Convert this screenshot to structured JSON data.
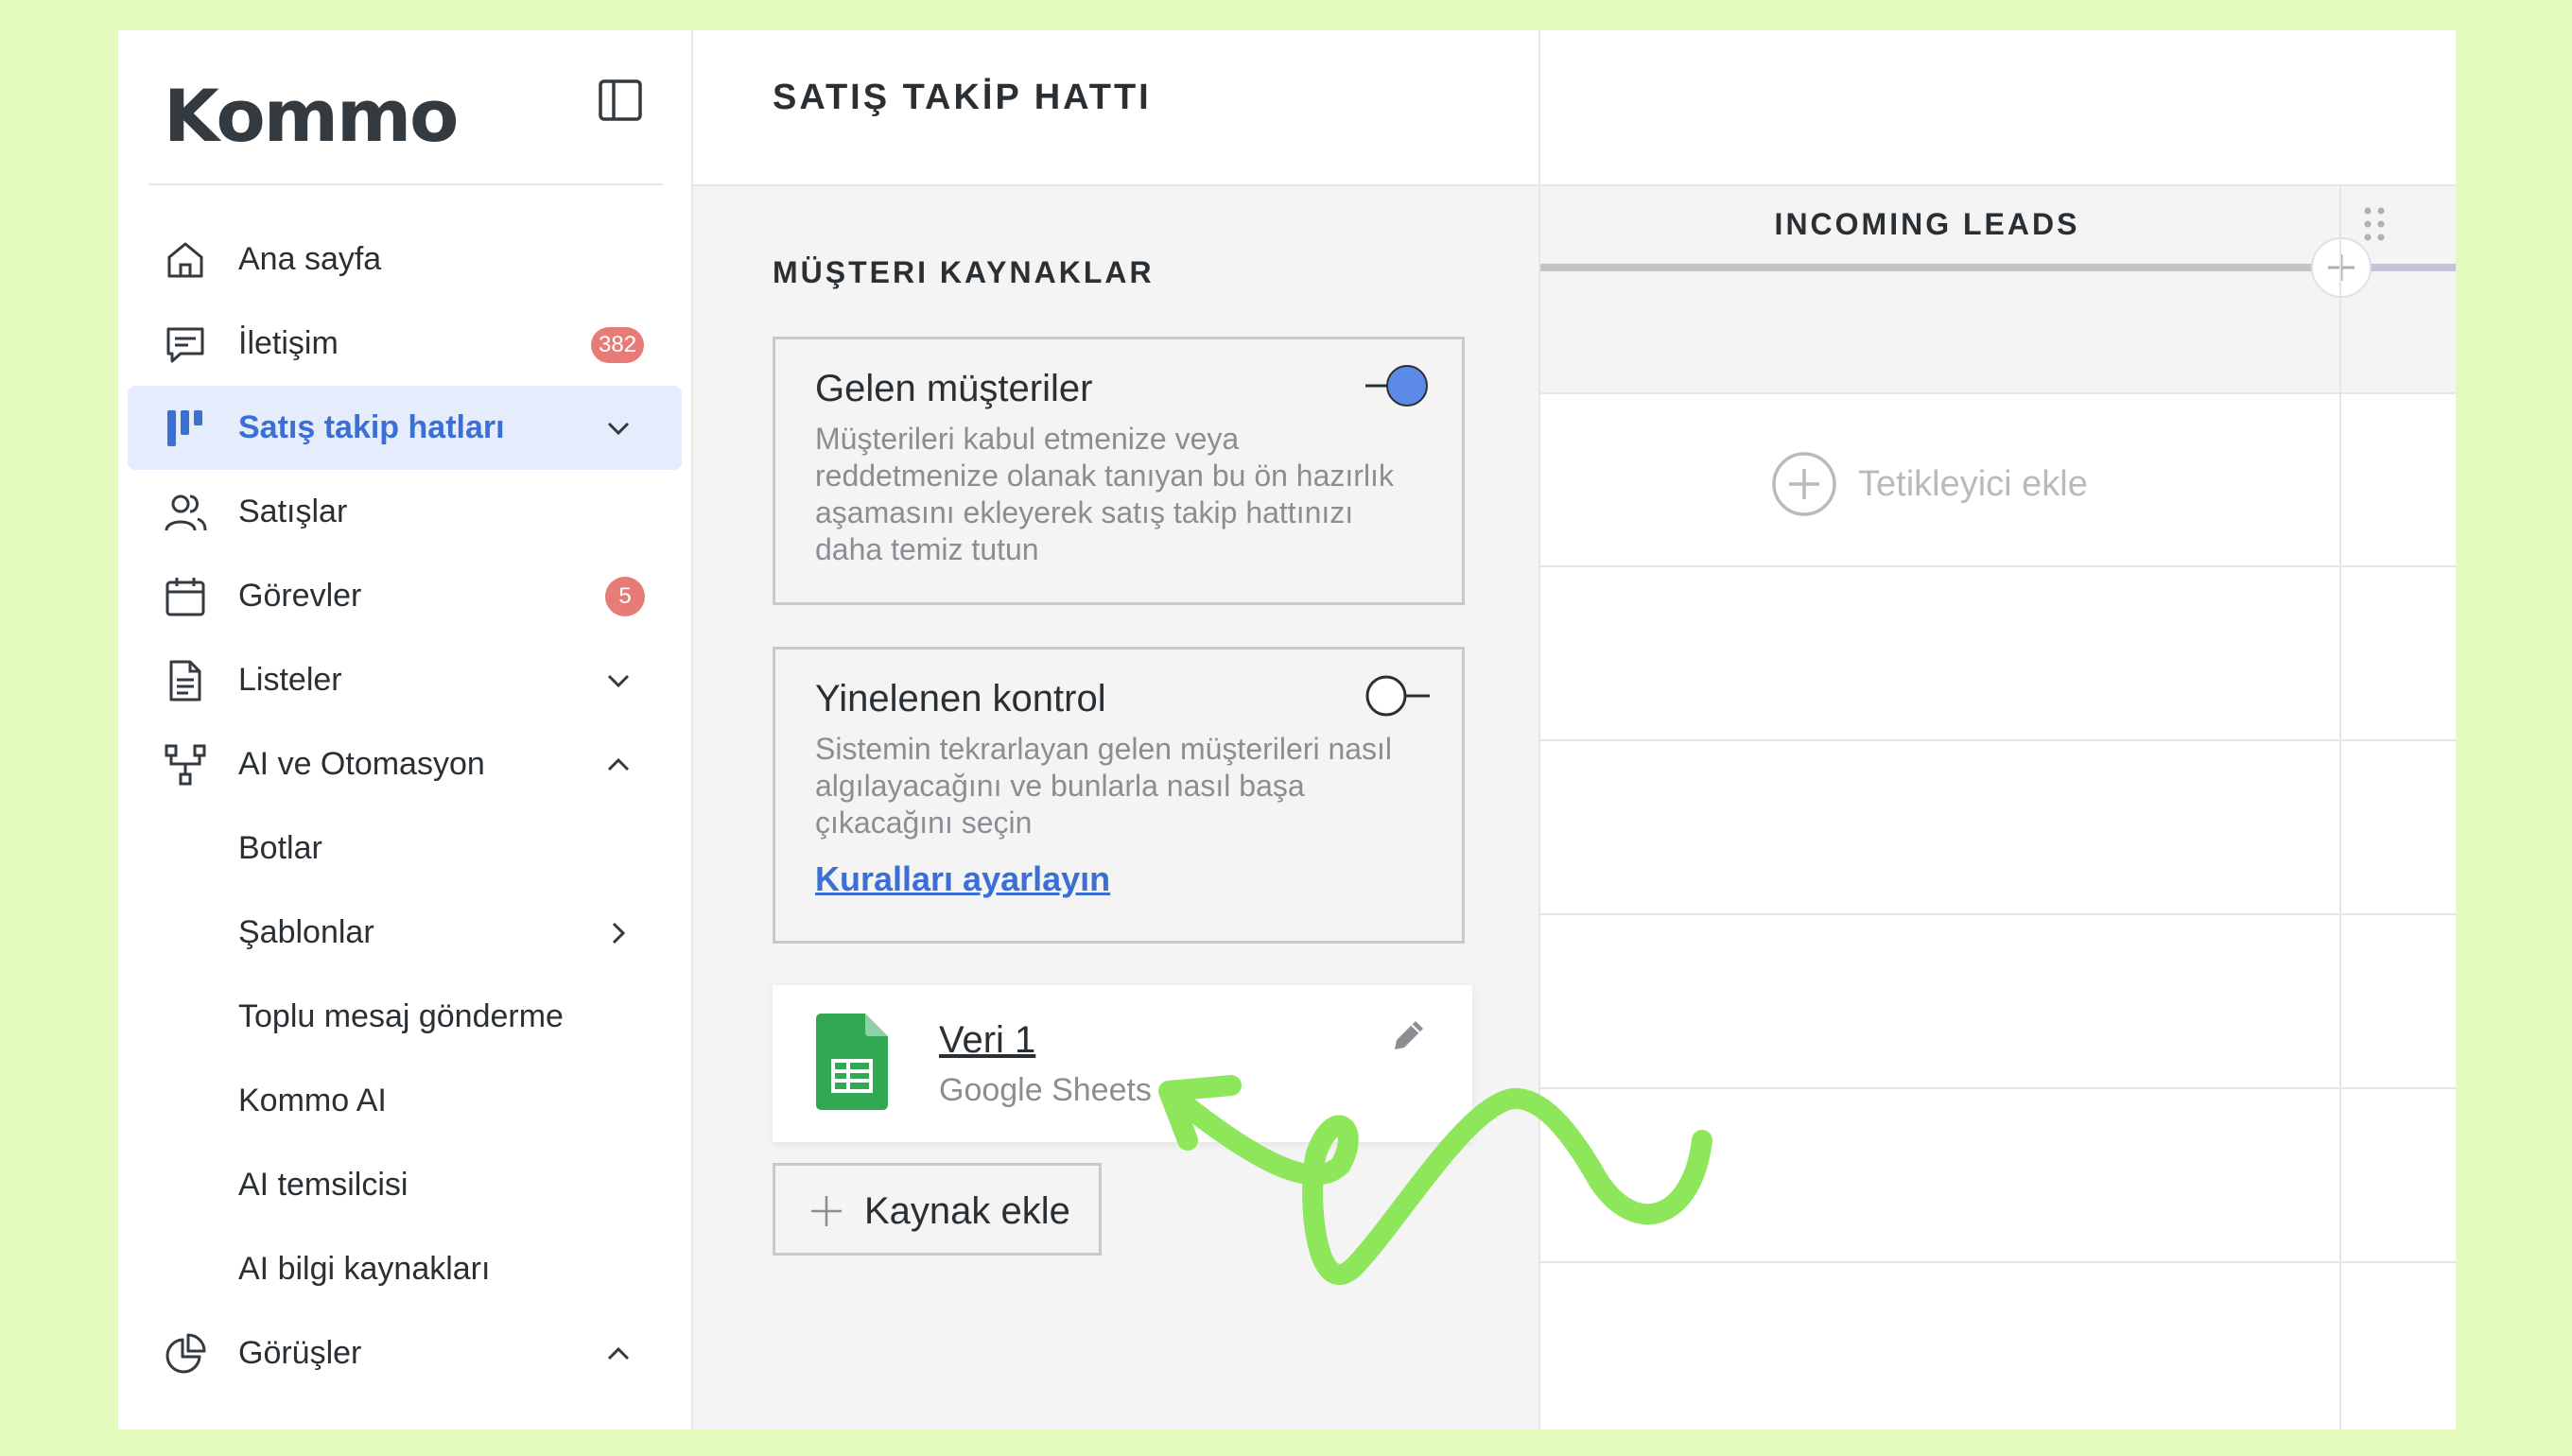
{
  "sidebar": {
    "logo": "Kommo",
    "items": [
      {
        "label": "Ana sayfa",
        "icon": "home-icon"
      },
      {
        "label": "İletişim",
        "icon": "chat-icon",
        "badge": "382"
      },
      {
        "label": "Satış takip hatları",
        "icon": "pipeline-icon",
        "active": true
      },
      {
        "label": "Satışlar",
        "icon": "users-icon"
      },
      {
        "label": "Görevler",
        "icon": "calendar-icon",
        "badge": "5"
      },
      {
        "label": "Listeler",
        "icon": "document-icon"
      },
      {
        "label": "AI ve Otomasyon",
        "icon": "workflow-icon"
      },
      {
        "label": "Botlar"
      },
      {
        "label": "Şablonlar"
      },
      {
        "label": "Toplu mesaj gönderme"
      },
      {
        "label": "Kommo AI"
      },
      {
        "label": "AI temsilcisi"
      },
      {
        "label": "AI bilgi kaynakları"
      },
      {
        "label": "Görüşler",
        "icon": "pie-chart-icon"
      }
    ]
  },
  "main": {
    "title": "SATIŞ TAKİP HATTI",
    "section_title": "MÜŞTERI KAYNAKLAR",
    "cards": [
      {
        "title": "Gelen müşteriler",
        "description": "Müşterileri kabul etmenize veya reddetmenize olanak tanıyan bu ön hazırlık aşamasını ekleyerek satış takip hattınızı daha temiz tutun",
        "toggle_on": true
      },
      {
        "title": "Yinelenen kontrol",
        "description": "Sistemin tekrarlayan gelen müşterileri nasıl algılayacağını ve bunlarla nasıl başa çıkacağını seçin",
        "link": "Kuralları ayarlayın",
        "toggle_on": false
      }
    ],
    "source": {
      "name": "Veri 1",
      "type": "Google Sheets",
      "icon": "google-sheets-icon"
    },
    "add_source_label": "Kaynak ekle"
  },
  "pipeline": {
    "column_title": "INCOMING LEADS",
    "trigger_label": "Tetikleyici ekle"
  },
  "colors": {
    "accent": "#3b6fd4",
    "badge": "#e77b78",
    "annotation_arrow": "#8ee65b",
    "background": "#e2fbbd"
  }
}
